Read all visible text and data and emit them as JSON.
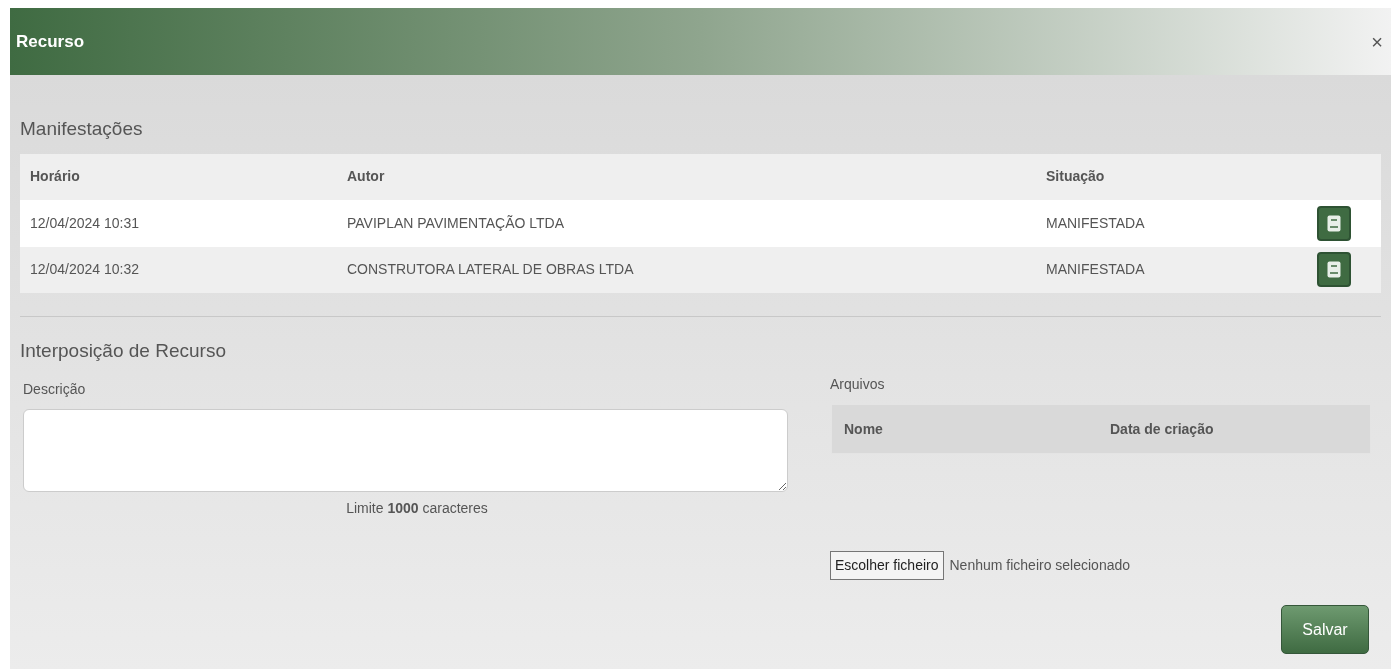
{
  "dialog": {
    "title": "Recurso",
    "close": "×"
  },
  "manifestacoes": {
    "heading": "Manifestações",
    "columns": [
      "Horário",
      "Autor",
      "Situação"
    ],
    "rows": [
      {
        "horario": "12/04/2024 10:31",
        "autor": "PAVIPLAN PAVIMENTAÇÃO LTDA",
        "situacao": "MANIFESTADA"
      },
      {
        "horario": "12/04/2024 10:32",
        "autor": "CONSTRUTORA LATERAL DE OBRAS LTDA",
        "situacao": "MANIFESTADA"
      }
    ]
  },
  "interposicao": {
    "heading": "Interposição de Recurso",
    "description_label": "Descrição",
    "limit_note": "Limite **1000** caracteres",
    "files": {
      "label": "Arquivos",
      "columns": [
        "Nome",
        "Data de criação"
      ]
    },
    "file_button": "Escolher ficheiro",
    "file_status": "Nenhum ficheiro selecionado",
    "save": "Salvar"
  }
}
